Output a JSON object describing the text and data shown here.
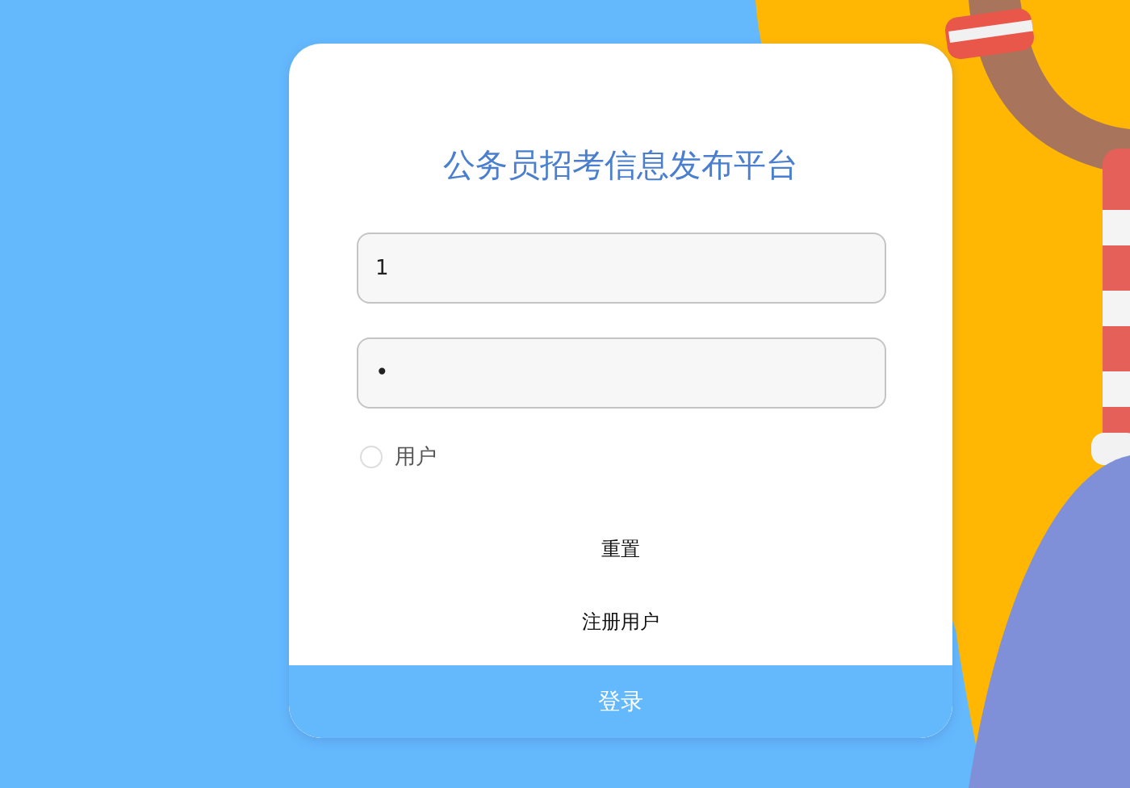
{
  "title": "公务员招考信息发布平台",
  "fields": [
    {
      "kind": "text",
      "value": "1"
    },
    {
      "kind": "password",
      "value": "•"
    }
  ],
  "roles": [
    {
      "label": "用户",
      "selected": false
    }
  ],
  "buttons": [
    {
      "label": "重置"
    },
    {
      "label": "注册用户"
    }
  ],
  "login_button": {
    "label": "登录"
  }
}
